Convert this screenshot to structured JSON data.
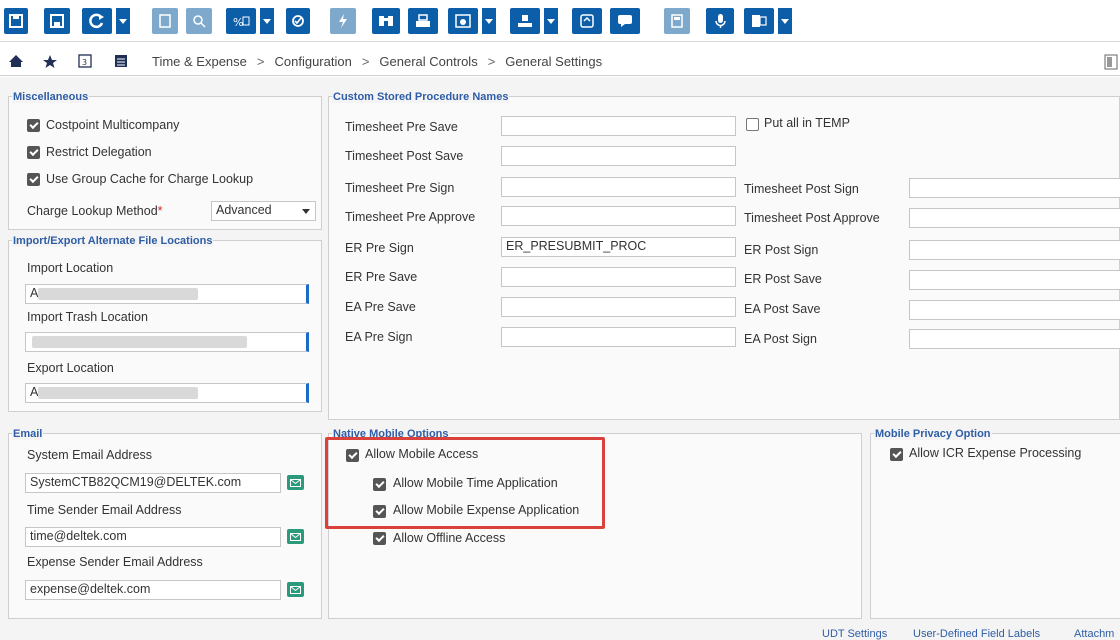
{
  "breadcrumb": [
    "Time & Expense",
    "Configuration",
    "General Controls",
    "General Settings"
  ],
  "toolbar_icons": [
    "save-icon",
    "save-close-icon",
    "refresh-icon",
    "copy-icon",
    "search-icon",
    "query-icon",
    "execute-icon",
    "lightning-icon",
    "lookup-icon",
    "print-icon",
    "preview-icon",
    "export-icon",
    "notes-icon",
    "chat-icon",
    "calculator-icon",
    "microphone-icon",
    "excel-icon"
  ],
  "nav_icons": [
    "home-icon",
    "star-icon",
    "calendar-icon",
    "table-icon"
  ],
  "misc": {
    "title": "Miscellaneous",
    "costpoint_multicompany": "Costpoint Multicompany",
    "restrict_delegation": "Restrict Delegation",
    "use_group_cache": "Use Group Cache for Charge Lookup",
    "charge_lookup_method_label": "Charge Lookup Method",
    "required_mark": "*",
    "charge_lookup_method_value": "Advanced"
  },
  "import_export": {
    "title": "Import/Export Alternate File Locations",
    "import_location": "Import Location",
    "import_value_prefix": "A",
    "import_trash_location": "Import Trash Location",
    "export_location": "Export Location",
    "export_value_prefix": "A"
  },
  "email": {
    "title": "Email",
    "system_email_label": "System Email Address",
    "system_email_value": "SystemCTB82QCM19@DELTEK.com",
    "time_sender_label": "Time Sender Email Address",
    "time_sender_value": "time@deltek.com",
    "expense_sender_label": "Expense Sender Email Address",
    "expense_sender_value": "expense@deltek.com"
  },
  "stored_procs": {
    "title": "Custom Stored Procedure Names",
    "timesheet_pre_save": "Timesheet Pre Save",
    "put_all_in_temp": "Put all in TEMP",
    "timesheet_post_save": "Timesheet Post Save",
    "timesheet_pre_sign": "Timesheet Pre Sign",
    "timesheet_post_sign": "Timesheet Post Sign",
    "timesheet_pre_approve": "Timesheet Pre Approve",
    "timesheet_post_approve": "Timesheet Post Approve",
    "er_pre_sign": "ER Pre Sign",
    "er_pre_sign_value": "ER_PRESUBMIT_PROC",
    "er_post_sign": "ER Post Sign",
    "er_pre_save": "ER Pre Save",
    "er_post_save": "ER Post Save",
    "ea_pre_save": "EA Pre Save",
    "ea_post_save": "EA Post Save",
    "ea_pre_sign": "EA Pre Sign",
    "ea_post_sign": "EA Post Sign"
  },
  "native_mobile": {
    "title": "Native Mobile Options",
    "allow_mobile_access": "Allow Mobile Access",
    "allow_mobile_time": "Allow Mobile Time Application",
    "allow_mobile_expense": "Allow Mobile Expense Application",
    "allow_offline": "Allow Offline Access"
  },
  "mobile_privacy": {
    "title": "Mobile Privacy Option",
    "allow_icr": "Allow ICR Expense Processing"
  },
  "footer": {
    "udt_settings": "UDT Settings",
    "user_defined_labels": "User-Defined Field Labels",
    "attachments": "Attachm"
  },
  "colors": {
    "toolbar_blue": "#0d5ea8",
    "section_title": "#2f5da6",
    "highlight_red": "#d9413a",
    "email_button": "#2a9a7a"
  }
}
